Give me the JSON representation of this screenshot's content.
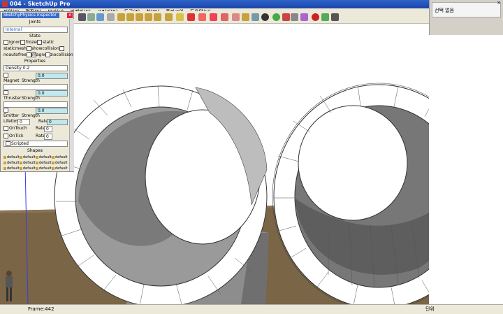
{
  "window": {
    "title": "004 - SketchUp Pro"
  },
  "menu": [
    "파일(F)",
    "편집(E)",
    "보기(V)",
    "카메라(C)",
    "그리기(R)",
    "도구(T)",
    "창(W)",
    "플러그인",
    "도움말(H)"
  ],
  "toolbar": {
    "icons": [
      "select-icon",
      "eraser-icon",
      "paint-icon",
      "box-icon",
      "cylinder-icon",
      "cone-icon",
      "pyramid-icon",
      "torus-icon",
      "push-icon",
      "line-icon",
      "rect-icon",
      "circle-icon",
      "arc-icon",
      "move-icon",
      "rotate-icon",
      "scale-icon",
      "orbit-icon",
      "zoom-icon",
      "play-icon",
      "record-icon",
      "stop-icon"
    ]
  },
  "right_panel": {
    "header": "선택 없음"
  },
  "physics_panel": {
    "title": "SketchyPhysics Inspector",
    "joints_header": "Joints",
    "joints_value": "Internal",
    "state_header": "State",
    "state_options": [
      "Ignore",
      "frozen",
      "static",
      "staticmesh",
      "showcollision",
      "noautofreeze",
      "magnetic",
      "nocollision"
    ],
    "properties_header": "Properties",
    "density_label": "Density",
    "density_value": "0.2",
    "magnet_label": "Magnet",
    "magnet_strength_label": "Strength",
    "magnet_value": "0.0",
    "thruster_label": "Thruster",
    "thruster_strength_label": "Strength",
    "thruster_value": "0.0",
    "emitter_label": "Emitter",
    "emitter_strength_label": "Strength",
    "emitter_value": "0.0",
    "lifetime_label": "Lifetime",
    "lifetime_value": "0",
    "rate_label": "Rate",
    "rate_value": "0",
    "ontouch_label": "OnTouch",
    "ontouch_rate_label": "Rate",
    "ontouch_rate_value": "0",
    "ontick_label": "OnTick",
    "ontick_rate_label": "Rate",
    "ontick_rate_value": "0",
    "scripted_label": "Scripted",
    "shapes_header": "Shapes",
    "shape_label": "default"
  },
  "status": {
    "frame": "Frame:442",
    "unit": "단위"
  }
}
